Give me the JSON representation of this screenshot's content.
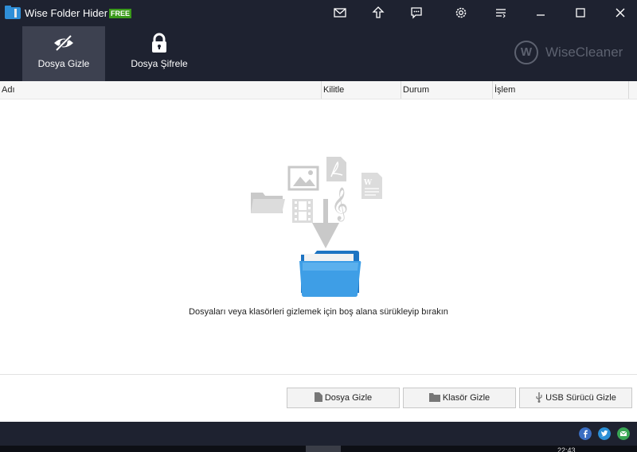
{
  "app": {
    "title": "Wise Folder Hider",
    "edition_badge": "FREE",
    "brand": "WiseCleaner",
    "brand_mark": "W",
    "accent_color": "#1e2230"
  },
  "title_icons": [
    "mail-icon",
    "upgrade-icon",
    "feedback-icon",
    "settings-icon",
    "menu-icon",
    "minimize-icon",
    "maximize-icon",
    "close-icon"
  ],
  "tabs": [
    {
      "label": "Dosya Gizle",
      "icon": "eye-slash-icon",
      "active": true
    },
    {
      "label": "Dosya Şifrele",
      "icon": "lock-icon",
      "active": false
    }
  ],
  "table": {
    "columns": [
      "Adı",
      "Kilitle",
      "Durum",
      "İşlem"
    ]
  },
  "empty_state": {
    "message": "Dosyaları veya klasörleri gizlemek için boş alana sürükleyip bırakın"
  },
  "buttons": {
    "hide_file": "Dosya Gizle",
    "hide_folder": "Klasör Gizle",
    "hide_usb": "USB Sürücü Gizle"
  },
  "social": [
    "facebook-icon",
    "twitter-icon",
    "email-icon"
  ],
  "taskbar": {
    "clock": "22:43"
  }
}
